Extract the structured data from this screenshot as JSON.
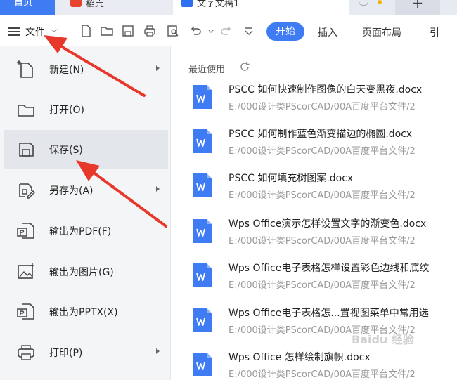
{
  "tabs": {
    "home": "首页",
    "daoke": "稻壳",
    "doc": "文字文稿1",
    "plus": "+"
  },
  "toolbar": {
    "file_label": "文件",
    "start": "开始",
    "insert": "插入",
    "layout": "页面布局",
    "ref": "引"
  },
  "menu": {
    "items": [
      {
        "label": "新建(N)",
        "icon": "new-file-icon",
        "has_arrow": true
      },
      {
        "label": "打开(O)",
        "icon": "folder-icon",
        "has_arrow": false
      },
      {
        "label": "保存(S)",
        "icon": "save-icon",
        "has_arrow": false,
        "selected": true
      },
      {
        "label": "另存为(A)",
        "icon": "save-as-icon",
        "has_arrow": true
      },
      {
        "label": "输出为PDF(F)",
        "icon": "pdf-export-icon",
        "has_arrow": false
      },
      {
        "label": "输出为图片(G)",
        "icon": "image-export-icon",
        "has_arrow": false
      },
      {
        "label": "输出为PPTX(X)",
        "icon": "pptx-export-icon",
        "has_arrow": false
      },
      {
        "label": "打印(P)",
        "icon": "printer-icon",
        "has_arrow": true
      }
    ]
  },
  "recent": {
    "title": "最近使用",
    "docs": [
      {
        "name": "PSCC 如何快速制作图像的白天变黑夜.docx",
        "path": "E:/000设计类PScorCAD/00A百度平台文件/2"
      },
      {
        "name": "PSCC 如何制作蓝色渐变描边的椭圆.docx",
        "path": "E:/000设计类PScorCAD/00A百度平台文件/2"
      },
      {
        "name": "PSCC 如何填充树图案.docx",
        "path": "E:/000设计类PScorCAD/00A百度平台文件/2"
      },
      {
        "name": "Wps Office演示怎样设置文字的渐变色.docx",
        "path": "E:/000设计类PScorCAD/00A百度平台文件/2"
      },
      {
        "name": "Wps Office电子表格怎样设置彩色边线和底纹",
        "path": "E:/000设计类PScorCAD/00A百度平台文件/2"
      },
      {
        "name": "Wps Office电子表格怎...置视图菜单中常用选",
        "path": "E:/000设计类PScorCAD/00A百度平台文件/2"
      },
      {
        "name": "Wps Office 怎样绘制旗帜.docx",
        "path": "E:/000设计类PScorCAD/00A百度平台文件/2"
      }
    ]
  },
  "watermark": "Baidu 经验",
  "colors": {
    "accent": "#3f7cf4",
    "word_icon": "#3f7cf4",
    "annotation_arrow": "#e8382c"
  }
}
